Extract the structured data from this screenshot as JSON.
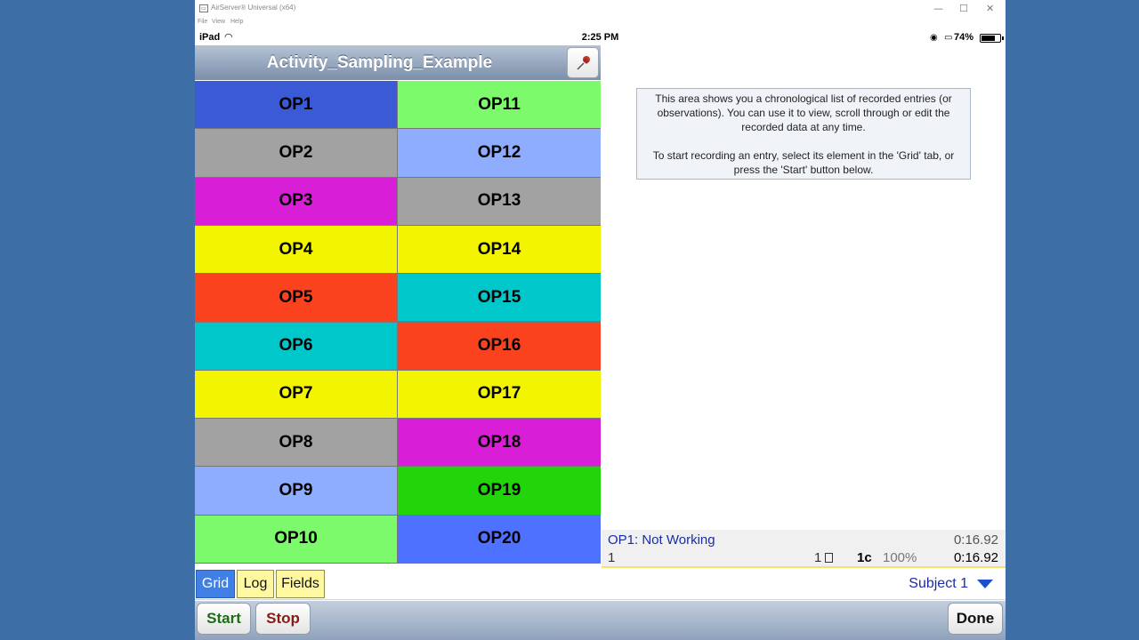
{
  "window": {
    "title": "AirServer® Universal (x64)",
    "menu": [
      "File",
      "View",
      "Help"
    ],
    "controls": {
      "minimize": "—",
      "maximize": "☐",
      "close": "✕"
    }
  },
  "statusbar": {
    "device": "iPad",
    "time": "2:25 PM",
    "battery": "74%",
    "battery_level": 0.74
  },
  "header": {
    "title": "Activity_Sampling_Example"
  },
  "grid": {
    "cells": [
      {
        "label": "OP1",
        "color": "#3b5ad6"
      },
      {
        "label": "OP11",
        "color": "#7cfa6c"
      },
      {
        "label": "OP2",
        "color": "#a2a2a2"
      },
      {
        "label": "OP12",
        "color": "#8eadff"
      },
      {
        "label": "OP3",
        "color": "#d81ed6"
      },
      {
        "label": "OP13",
        "color": "#a2a2a2"
      },
      {
        "label": "OP4",
        "color": "#f3f500"
      },
      {
        "label": "OP14",
        "color": "#f3f500"
      },
      {
        "label": "OP5",
        "color": "#fb421f"
      },
      {
        "label": "OP15",
        "color": "#00c7c9"
      },
      {
        "label": "OP6",
        "color": "#00c7c9"
      },
      {
        "label": "OP16",
        "color": "#fb421f"
      },
      {
        "label": "OP7",
        "color": "#f3f500"
      },
      {
        "label": "OP17",
        "color": "#f3f500"
      },
      {
        "label": "OP8",
        "color": "#a2a2a2"
      },
      {
        "label": "OP18",
        "color": "#d81ed6"
      },
      {
        "label": "OP9",
        "color": "#8eadff"
      },
      {
        "label": "OP19",
        "color": "#21d50a"
      },
      {
        "label": "OP10",
        "color": "#7cfa6c"
      },
      {
        "label": "OP20",
        "color": "#4f71ff"
      }
    ]
  },
  "log": {
    "info_p1": "This area shows you a chronological list of recorded entries (or observations). You can use it to view, scroll through or edit the recorded data at any time.",
    "info_p2": "To start recording an entry, select its element in the 'Grid' tab, or press the 'Start' button below."
  },
  "status_panel": {
    "current": "OP1: Not Working",
    "time1": "0:16.92",
    "count": "1",
    "obs": "1",
    "cycles": "1c",
    "percent": "100%",
    "time2": "0:16.92"
  },
  "tabs": [
    {
      "label": "Grid",
      "active": true
    },
    {
      "label": "Log",
      "active": false
    },
    {
      "label": "Fields",
      "active": false
    }
  ],
  "subject": "Subject 1",
  "toolbar": {
    "start": "Start",
    "stop": "Stop",
    "done": "Done"
  },
  "colors": {
    "start_text": "#1f6b18",
    "stop_text": "#8a1a12",
    "active_tab": "#3f7fe6",
    "inactive_tab": "#fff8a0"
  }
}
